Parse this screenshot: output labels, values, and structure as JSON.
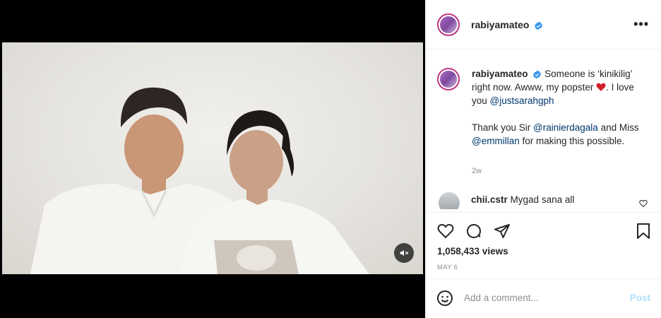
{
  "post": {
    "username": "rabiyamateo",
    "more_label": "•••",
    "caption_p1": "Someone is ‘kinikilig’ right now. Awww, my popster ",
    "caption_p2": ". I love you ",
    "mention1": "@justsarahgph",
    "caption_p3": "Thank you Sir ",
    "mention2": "@rainierdagala",
    "caption_p4": " and Miss ",
    "mention3": "@emmillan",
    "caption_p5": " for making this possible.",
    "time_ago": "2w"
  },
  "comment": {
    "username": "chii.cstr",
    "text": "Mygad sana all"
  },
  "stats": {
    "views": "1,058,433 views",
    "date": "MAY 6"
  },
  "add_comment": {
    "placeholder": "Add a comment...",
    "post_label": "Post"
  },
  "colors": {
    "accent": "#0095f6",
    "post_disabled": "#b2dffc",
    "mention": "#00376b",
    "heart": "#ed4956"
  },
  "icons": [
    "volume-off-icon",
    "verified-badge-icon",
    "more-options-icon",
    "like-heart-icon",
    "comment-icon",
    "share-icon",
    "save-bookmark-icon",
    "emoji-icon",
    "comment-like-icon"
  ]
}
